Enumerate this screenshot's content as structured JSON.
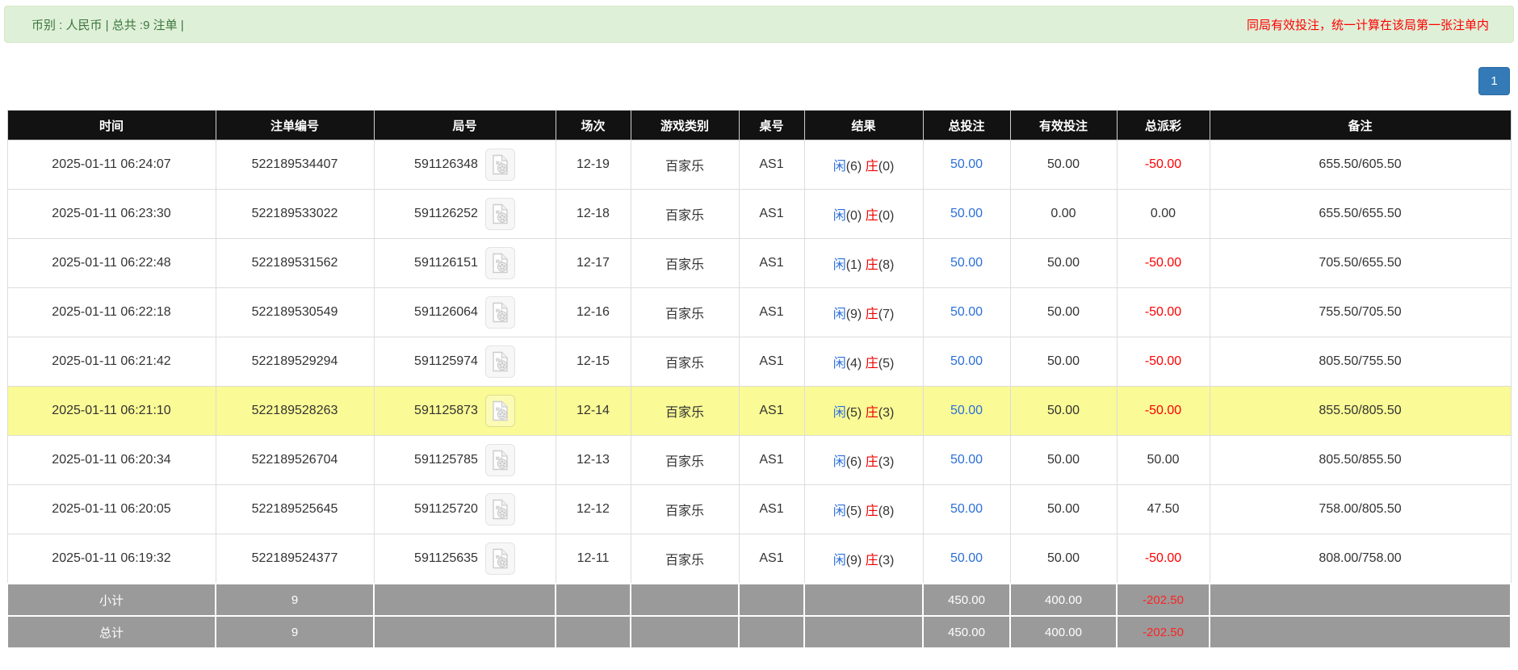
{
  "alert_bar": {
    "left_text": "币别 : 人民币 | 总共 :9 注单 |",
    "right_notice": "同局有效投注，统一计算在该局第一张注单内"
  },
  "pagination": {
    "current_page": "1"
  },
  "colors": {
    "alert_bg": "#dff0d8",
    "alert_text": "#3c763d",
    "notice_red": "#ff0000",
    "header_bg": "#121212",
    "link_blue": "#2b6fd9",
    "banker_red": "#ee0000",
    "highlight_yellow": "#fafa96",
    "totals_grey": "#9a9a9a",
    "page_btn_blue": "#337ab7"
  },
  "icons": {
    "round_cell_icon": "video-replay-film-document-icon"
  },
  "table": {
    "columns": [
      "时间",
      "注单编号",
      "局号",
      "场次",
      "游戏类别",
      "桌号",
      "结果",
      "总投注",
      "有效投注",
      "总派彩",
      "备注"
    ],
    "rows": [
      {
        "time": "2025-01-11 06:24:07",
        "bet_id": "522189534407",
        "round_id": "591126348",
        "session": "12-19",
        "game_type": "百家乐",
        "table_no": "AS1",
        "result": {
          "player_label": "闲",
          "player_score": "(6)",
          "banker_label": "庄",
          "banker_score": "(0)"
        },
        "total_bet": "50.00",
        "valid_bet": "50.00",
        "payout": "-50.00",
        "remark": "655.50/605.50",
        "highlighted": false
      },
      {
        "time": "2025-01-11 06:23:30",
        "bet_id": "522189533022",
        "round_id": "591126252",
        "session": "12-18",
        "game_type": "百家乐",
        "table_no": "AS1",
        "result": {
          "player_label": "闲",
          "player_score": "(0)",
          "banker_label": "庄",
          "banker_score": "(0)"
        },
        "total_bet": "50.00",
        "valid_bet": "0.00",
        "payout": "0.00",
        "remark": "655.50/655.50",
        "highlighted": false
      },
      {
        "time": "2025-01-11 06:22:48",
        "bet_id": "522189531562",
        "round_id": "591126151",
        "session": "12-17",
        "game_type": "百家乐",
        "table_no": "AS1",
        "result": {
          "player_label": "闲",
          "player_score": "(1)",
          "banker_label": "庄",
          "banker_score": "(8)"
        },
        "total_bet": "50.00",
        "valid_bet": "50.00",
        "payout": "-50.00",
        "remark": "705.50/655.50",
        "highlighted": false
      },
      {
        "time": "2025-01-11 06:22:18",
        "bet_id": "522189530549",
        "round_id": "591126064",
        "session": "12-16",
        "game_type": "百家乐",
        "table_no": "AS1",
        "result": {
          "player_label": "闲",
          "player_score": "(9)",
          "banker_label": "庄",
          "banker_score": "(7)"
        },
        "total_bet": "50.00",
        "valid_bet": "50.00",
        "payout": "-50.00",
        "remark": "755.50/705.50",
        "highlighted": false
      },
      {
        "time": "2025-01-11 06:21:42",
        "bet_id": "522189529294",
        "round_id": "591125974",
        "session": "12-15",
        "game_type": "百家乐",
        "table_no": "AS1",
        "result": {
          "player_label": "闲",
          "player_score": "(4)",
          "banker_label": "庄",
          "banker_score": "(5)"
        },
        "total_bet": "50.00",
        "valid_bet": "50.00",
        "payout": "-50.00",
        "remark": "805.50/755.50",
        "highlighted": false
      },
      {
        "time": "2025-01-11 06:21:10",
        "bet_id": "522189528263",
        "round_id": "591125873",
        "session": "12-14",
        "game_type": "百家乐",
        "table_no": "AS1",
        "result": {
          "player_label": "闲",
          "player_score": "(5)",
          "banker_label": "庄",
          "banker_score": "(3)"
        },
        "total_bet": "50.00",
        "valid_bet": "50.00",
        "payout": "-50.00",
        "remark": "855.50/805.50",
        "highlighted": true
      },
      {
        "time": "2025-01-11 06:20:34",
        "bet_id": "522189526704",
        "round_id": "591125785",
        "session": "12-13",
        "game_type": "百家乐",
        "table_no": "AS1",
        "result": {
          "player_label": "闲",
          "player_score": "(6)",
          "banker_label": "庄",
          "banker_score": "(3)"
        },
        "total_bet": "50.00",
        "valid_bet": "50.00",
        "payout": "50.00",
        "remark": "805.50/855.50",
        "highlighted": false
      },
      {
        "time": "2025-01-11 06:20:05",
        "bet_id": "522189525645",
        "round_id": "591125720",
        "session": "12-12",
        "game_type": "百家乐",
        "table_no": "AS1",
        "result": {
          "player_label": "闲",
          "player_score": "(5)",
          "banker_label": "庄",
          "banker_score": "(8)"
        },
        "total_bet": "50.00",
        "valid_bet": "50.00",
        "payout": "47.50",
        "remark": "758.00/805.50",
        "highlighted": false
      },
      {
        "time": "2025-01-11 06:19:32",
        "bet_id": "522189524377",
        "round_id": "591125635",
        "session": "12-11",
        "game_type": "百家乐",
        "table_no": "AS1",
        "result": {
          "player_label": "闲",
          "player_score": "(9)",
          "banker_label": "庄",
          "banker_score": "(3)"
        },
        "total_bet": "50.00",
        "valid_bet": "50.00",
        "payout": "-50.00",
        "remark": "808.00/758.00",
        "highlighted": false
      }
    ],
    "subtotal": {
      "label": "小计",
      "count": "9",
      "total_bet": "450.00",
      "valid_bet": "400.00",
      "payout": "-202.50"
    },
    "grand_total": {
      "label": "总计",
      "count": "9",
      "total_bet": "450.00",
      "valid_bet": "400.00",
      "payout": "-202.50"
    }
  }
}
